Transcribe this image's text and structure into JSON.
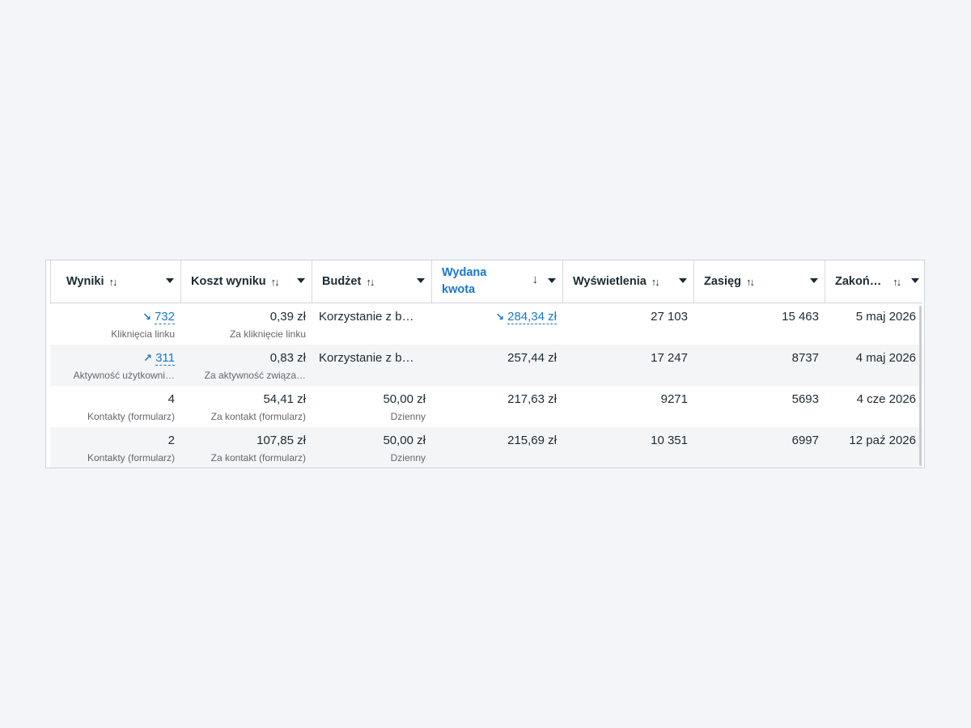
{
  "table": {
    "columns": [
      {
        "label": "Wyniki",
        "sort": "both"
      },
      {
        "label": "Koszt wyniku",
        "sort": "both"
      },
      {
        "label": "Budżet",
        "sort": "both"
      },
      {
        "label": "Wydana kwota",
        "sort": "desc",
        "active": true
      },
      {
        "label": "Wyświetlenia",
        "sort": "both"
      },
      {
        "label": "Zasięg",
        "sort": "both"
      },
      {
        "label": "Zakoń…",
        "sort": "both"
      }
    ],
    "rows": [
      {
        "results": {
          "value": "732",
          "trend": "down",
          "sub": "Kliknięcia linku"
        },
        "cost": {
          "value": "0,39 zł",
          "sub": "Za kliknięcie linku"
        },
        "budget": {
          "value": "Korzystanie z b…",
          "sub": ""
        },
        "spent": {
          "value": "284,34 zł",
          "trend": "down"
        },
        "impressions": "27 103",
        "reach": "15 463",
        "end": "5 maj 2026"
      },
      {
        "results": {
          "value": "311",
          "trend": "up",
          "sub": "Aktywność użytkowni…"
        },
        "cost": {
          "value": "0,83 zł",
          "sub": "Za aktywność związa…"
        },
        "budget": {
          "value": "Korzystanie z b…",
          "sub": ""
        },
        "spent": {
          "value": "257,44 zł",
          "trend": ""
        },
        "impressions": "17 247",
        "reach": "8737",
        "end": "4 maj 2026"
      },
      {
        "results": {
          "value": "4",
          "trend": "",
          "sub": "Kontakty (formularz)"
        },
        "cost": {
          "value": "54,41 zł",
          "sub": "Za kontakt (formularz)"
        },
        "budget": {
          "value": "50,00 zł",
          "sub": "Dzienny"
        },
        "spent": {
          "value": "217,63 zł",
          "trend": ""
        },
        "impressions": "9271",
        "reach": "5693",
        "end": "4 cze 2026"
      },
      {
        "results": {
          "value": "2",
          "trend": "",
          "sub": "Kontakty (formularz)"
        },
        "cost": {
          "value": "107,85 zł",
          "sub": "Za kontakt (formularz)"
        },
        "budget": {
          "value": "50,00 zł",
          "sub": "Dzienny"
        },
        "spent": {
          "value": "215,69 zł",
          "trend": ""
        },
        "impressions": "10 351",
        "reach": "6997",
        "end": "12 paź 2026"
      }
    ]
  },
  "colors": {
    "accent": "#1877d2",
    "text": "#1c2b33",
    "muted": "#65676b",
    "row_alt": "#f4f5f7",
    "page_bg": "#f4f5f9"
  },
  "icons": {
    "sort_both": "↑↓",
    "sort_desc": "↓",
    "trend_down": "↘",
    "trend_up": "↗"
  }
}
